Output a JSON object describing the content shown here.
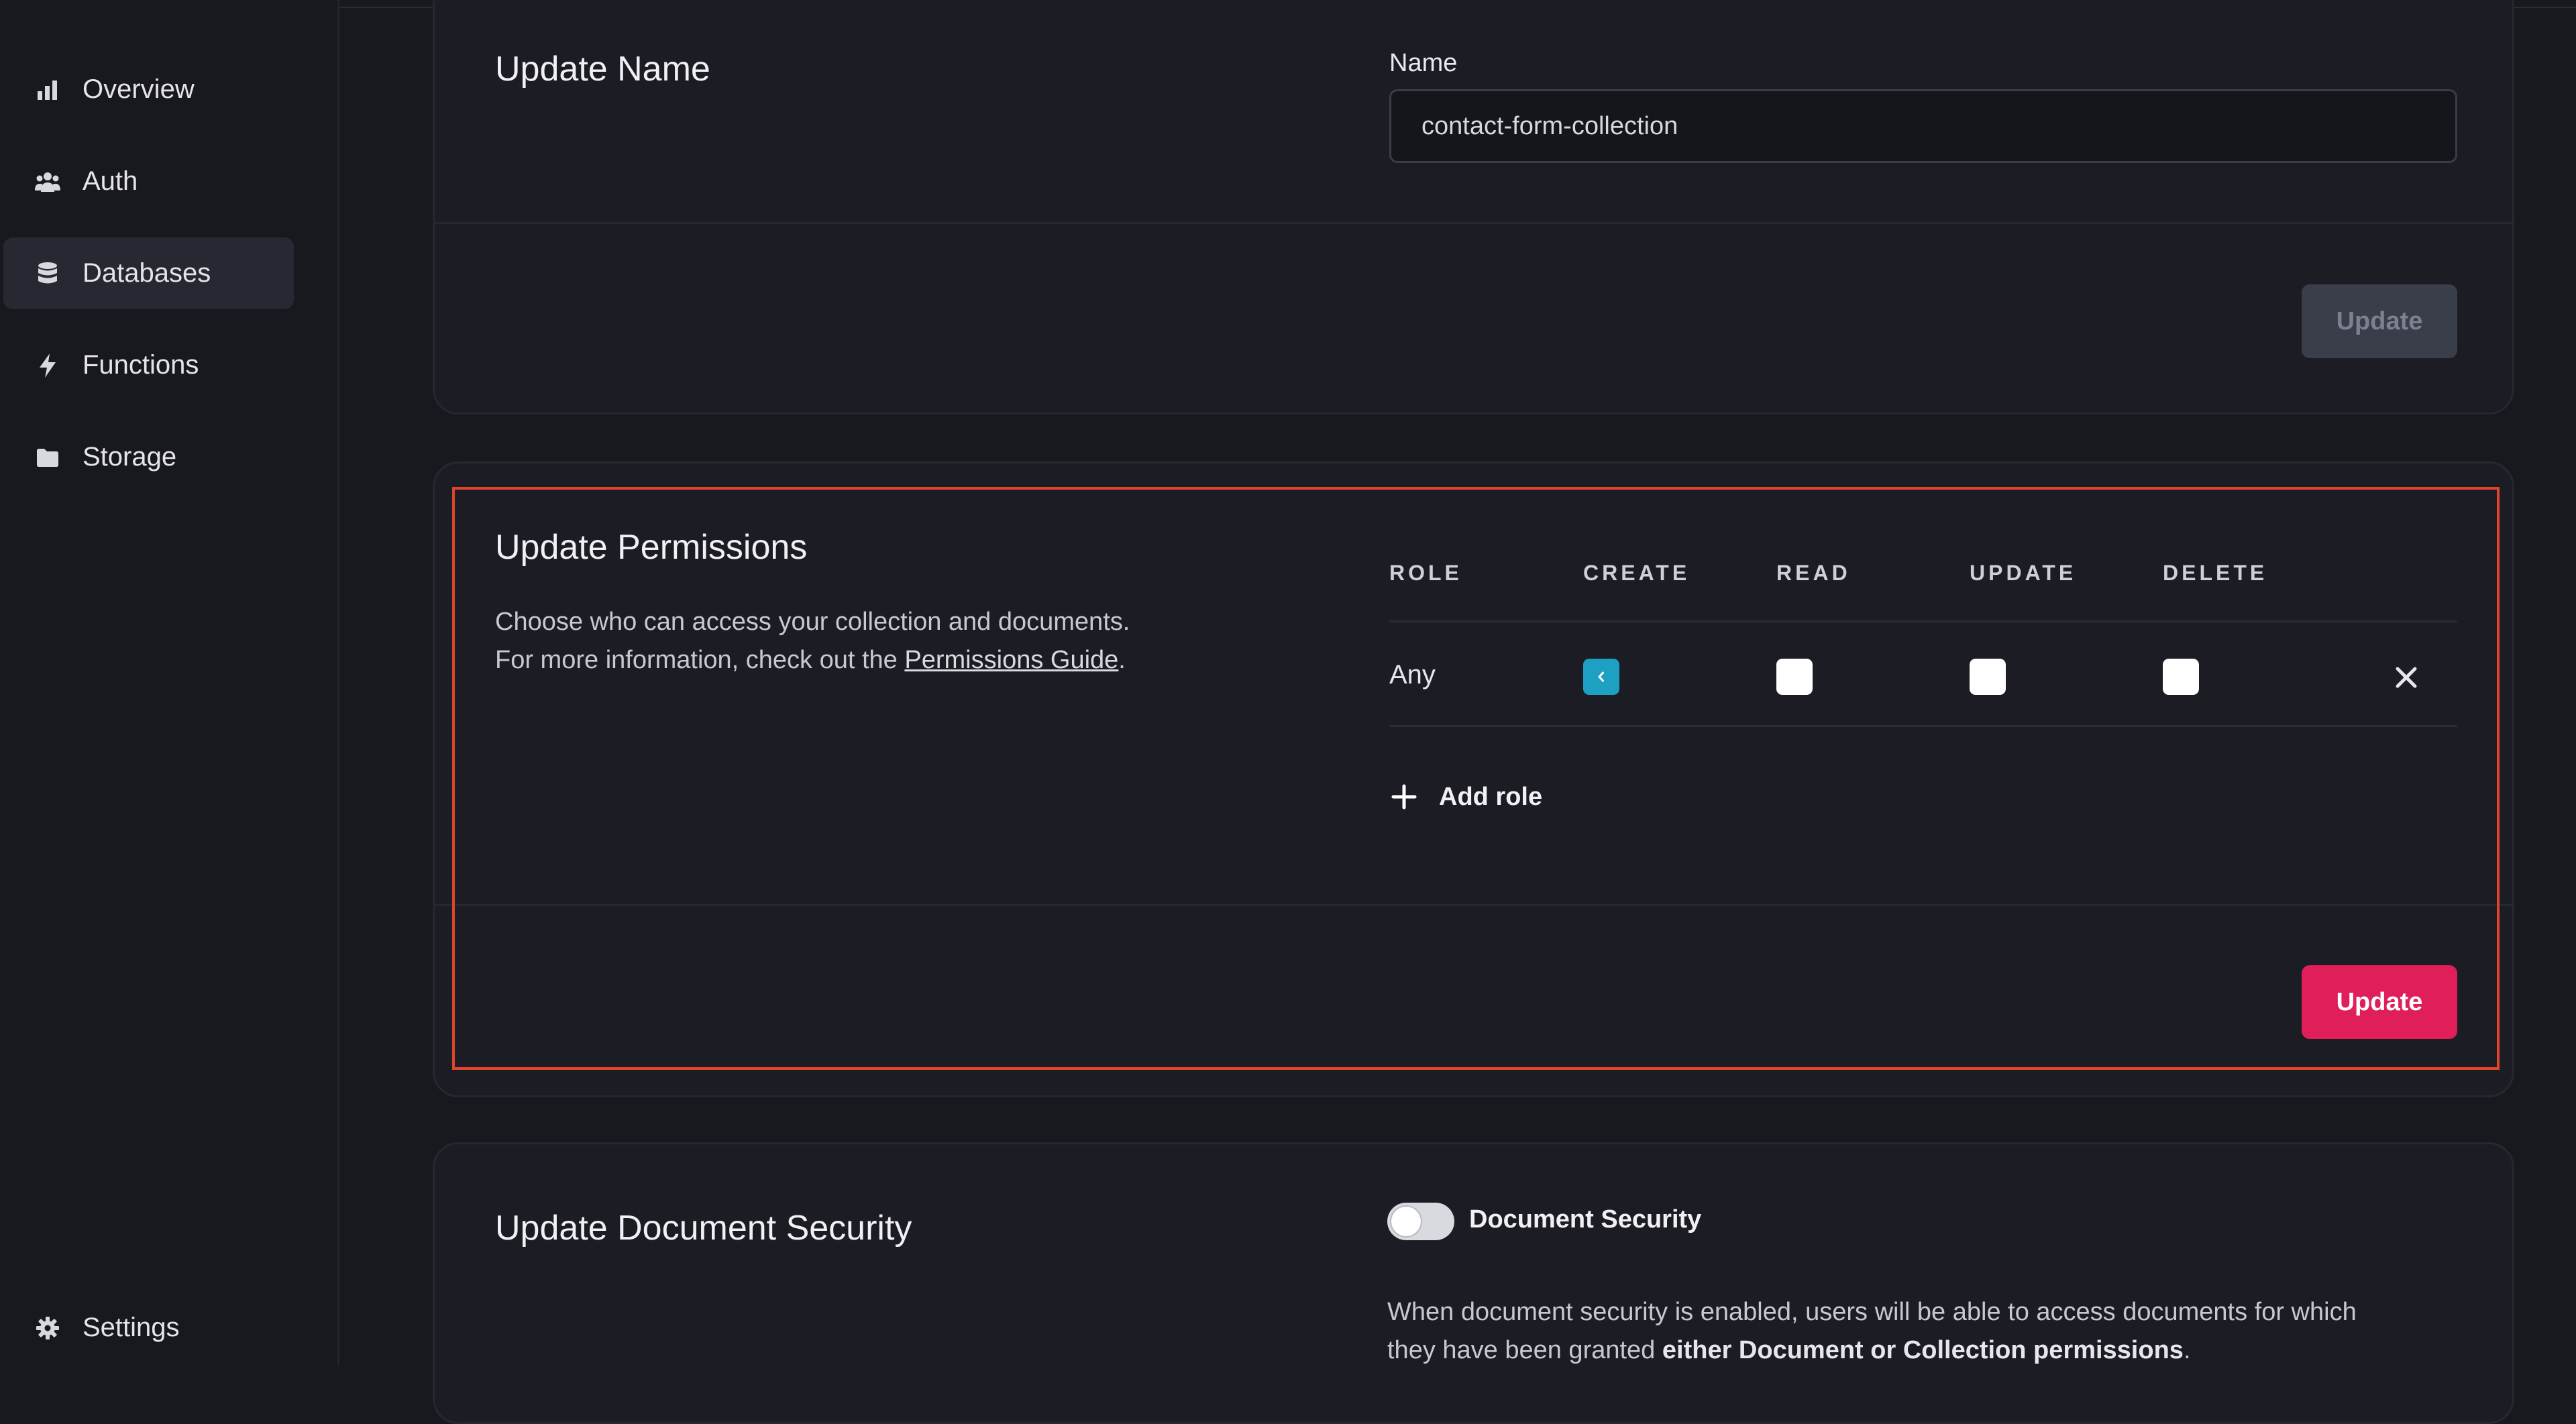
{
  "sidebar": {
    "items": [
      {
        "label": "Overview",
        "icon": "bar-chart-icon"
      },
      {
        "label": "Auth",
        "icon": "users-icon"
      },
      {
        "label": "Databases",
        "icon": "database-icon",
        "active": true
      },
      {
        "label": "Functions",
        "icon": "lightning-icon"
      },
      {
        "label": "Storage",
        "icon": "folder-icon"
      }
    ],
    "settings_label": "Settings"
  },
  "update_name": {
    "title": "Update Name",
    "field_label": "Name",
    "value": "contact-form-collection",
    "button_label": "Update"
  },
  "update_permissions": {
    "title": "Update Permissions",
    "desc_line1": "Choose who can access your collection and documents.",
    "desc_line2_prefix": "For more information, check out the",
    "guide_link": "Permissions Guide",
    "desc_line2_suffix": ".",
    "columns": [
      "ROLE",
      "CREATE",
      "READ",
      "UPDATE",
      "DELETE"
    ],
    "rows": [
      {
        "role": "Any",
        "create": true,
        "read": false,
        "update": false,
        "delete": false
      }
    ],
    "add_role_label": "Add role",
    "button_label": "Update"
  },
  "document_security": {
    "title": "Update Document Security",
    "toggle_label": "Document Security",
    "toggle_on": false,
    "desc_prefix": "When document security is enabled, users will be able to access documents for which",
    "desc_line2_prefix": "they have been granted",
    "desc_bold": "either Document or Collection permissions",
    "desc_suffix": "."
  },
  "colors": {
    "accent": "#e01e5a",
    "checkbox_checked": "#1ea0c3",
    "highlight": "#e0452b"
  }
}
